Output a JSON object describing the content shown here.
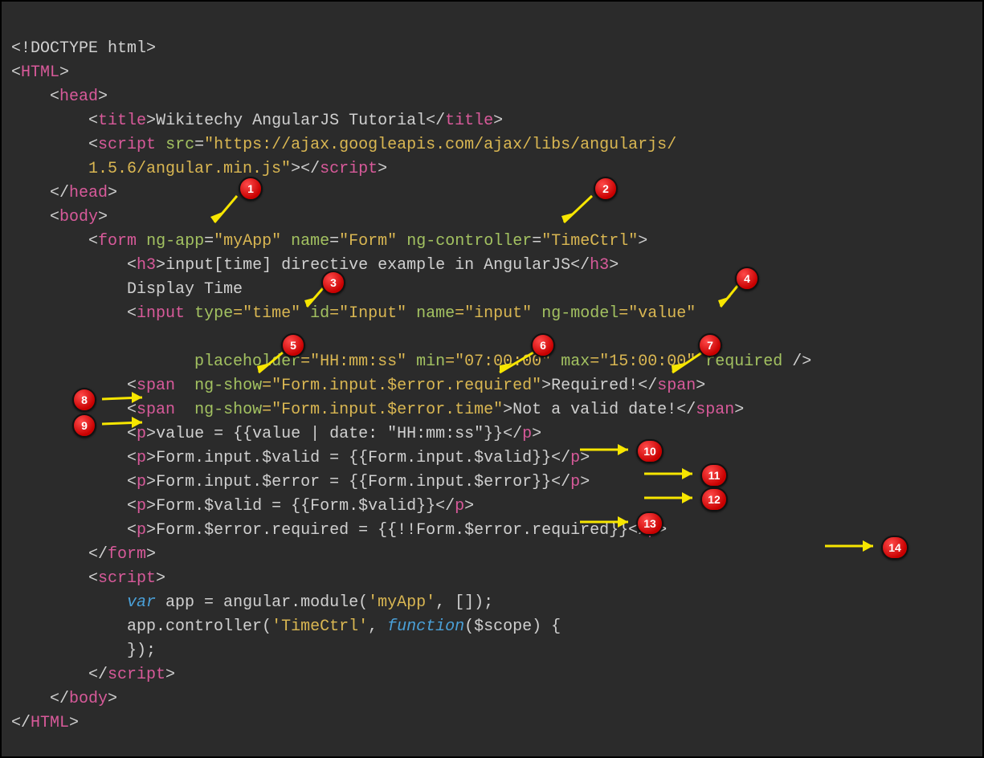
{
  "lines": {
    "l1a": "<!DOCTYPE html>",
    "l2_open": "<",
    "l2_tag": "HTML",
    "l2_close": ">",
    "l3_open": "    <",
    "l3_tag": "head",
    "l3_close": ">",
    "l4_open": "        <",
    "l4_tag": "title",
    "l4_gt": ">",
    "l4_text": "Wikitechy AngularJS Tutorial",
    "l4_ct": "</",
    "l4_tag2": "title",
    "l4_end": ">",
    "l5_open": "        <",
    "l5_tag": "script",
    "l5_sp": " ",
    "l5_attr": "src",
    "l5_eq": "=",
    "l5_val": "\"https://ajax.googleapis.com/ajax/libs/angularjs/",
    "l6_val": "        1.5.6/angular.min.js\"",
    "l6_gt": ">",
    "l6_ct": "</",
    "l6_tag": "script",
    "l6_end": ">",
    "l7_open": "    </",
    "l7_tag": "head",
    "l7_close": ">",
    "l8_open": "    <",
    "l8_tag": "body",
    "l8_close": ">",
    "l9_open": "        <",
    "l9_tag": "form",
    "l9_sp": " ",
    "l9_a1": "ng-app",
    "l9_eq1": "=",
    "l9_v1": "\"myApp\"",
    "l9_sp2": " ",
    "l9_a2": "name",
    "l9_eq2": "=",
    "l9_v2": "\"Form\"",
    "l9_sp3": " ",
    "l9_a3": "ng-controller",
    "l9_eq3": "=",
    "l9_v3": "\"TimeCtrl\"",
    "l9_end": ">",
    "l10_open": "            <",
    "l10_tag": "h3",
    "l10_gt": ">",
    "l10_text": "input[time] directive example in AngularJS",
    "l10_ct": "</",
    "l10_tag2": "h3",
    "l10_end": ">",
    "l11": "            Display Time ",
    "l12_open": "            <",
    "l12_tag": "input",
    "l12_sp": " ",
    "l12_a1": "type",
    "l12_v1": "=\"time\"",
    "l12_sp2": " ",
    "l12_a2": "id",
    "l12_v2": "=\"Input\"",
    "l12_sp3": " ",
    "l12_a3": "name",
    "l12_v3": "=\"input\"",
    "l12_sp4": " ",
    "l12_a4": "ng-model",
    "l12_v4": "=\"value\"",
    "l13_pad": "                   ",
    "l14_pad": "                   ",
    "l14_a1": "placeholder",
    "l14_v1": "=\"HH:mm:ss\"",
    "l14_sp": " ",
    "l14_a2": "min",
    "l14_v2": "=\"07:00:00\"",
    "l14_sp2": " ",
    "l14_a3": "max",
    "l14_v3": "=\"15:00:00\"",
    "l14_sp3": " ",
    "l14_a4": "required",
    "l14_end": " />",
    "l15_open": "            <",
    "l15_tag": "span",
    "l15_sp": "  ",
    "l15_a": "ng-show",
    "l15_v": "=\"Form.input.$error.required\"",
    "l15_gt": ">",
    "l15_text": "Required!",
    "l15_ct": "</",
    "l15_tag2": "span",
    "l15_end": ">",
    "l16_open": "            <",
    "l16_tag": "span",
    "l16_sp": "  ",
    "l16_a": "ng-show",
    "l16_v": "=\"Form.input.$error.time\"",
    "l16_gt": ">",
    "l16_text": "Not a valid date!",
    "l16_ct": "</",
    "l16_tag2": "span",
    "l16_end": ">",
    "l17_open": "            <",
    "l17_tag": "p",
    "l17_gt": ">",
    "l17_text": "value = {{value | date: \"HH:mm:ss\"}}",
    "l17_ct": "</",
    "l17_tag2": "p",
    "l17_end": ">",
    "l18_open": "            <",
    "l18_tag": "p",
    "l18_gt": ">",
    "l18_text": "Form.input.$valid = {{Form.input.$valid}}",
    "l18_ct": "</",
    "l18_tag2": "p",
    "l18_end": ">",
    "l19_open": "            <",
    "l19_tag": "p",
    "l19_gt": ">",
    "l19_text": "Form.input.$error = {{Form.input.$error}}",
    "l19_ct": "</",
    "l19_tag2": "p",
    "l19_end": ">",
    "l20_open": "            <",
    "l20_tag": "p",
    "l20_gt": ">",
    "l20_text": "Form.$valid = {{Form.$valid}}",
    "l20_ct": "</",
    "l20_tag2": "p",
    "l20_end": ">",
    "l21_open": "            <",
    "l21_tag": "p",
    "l21_gt": ">",
    "l21_text": "Form.$error.required = {{!!Form.$error.required}}",
    "l21_ct": "</",
    "l21_tag2": "p",
    "l21_end": ">",
    "l22_open": "        </",
    "l22_tag": "form",
    "l22_end": ">",
    "l23_open": "        <",
    "l23_tag": "script",
    "l23_end": ">",
    "l24_pad": "            ",
    "l24_var": "var",
    "l24_text": " app = angular.module(",
    "l24_str": "'myApp'",
    "l24_text2": ", []);",
    "l25_pad": "            ",
    "l25_text": "app.controller(",
    "l25_str": "'TimeCtrl'",
    "l25_text2": ", ",
    "l25_fn": "function",
    "l25_text3": "($scope) {",
    "l26": "            });",
    "l27_open": "        </",
    "l27_tag": "script",
    "l27_end": ">",
    "l28_open": "    </",
    "l28_tag": "body",
    "l28_end": ">",
    "l29_open": "</",
    "l29_tag": "HTML",
    "l29_end": ">"
  },
  "badges": {
    "b1": "1",
    "b2": "2",
    "b3": "3",
    "b4": "4",
    "b5": "5",
    "b6": "6",
    "b7": "7",
    "b8": "8",
    "b9": "9",
    "b10": "10",
    "b11": "11",
    "b12": "12",
    "b13": "13",
    "b14": "14"
  }
}
